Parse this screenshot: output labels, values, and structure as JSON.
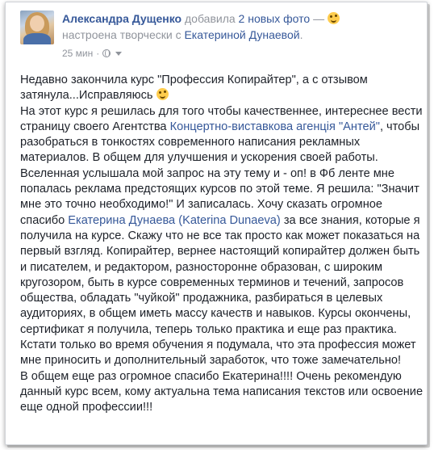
{
  "author": {
    "name": "Александра Дущенко",
    "action": "добавила",
    "photos_link": "2 новых фото",
    "dash": "—",
    "feeling_prefix": "настроена творчески с",
    "tagged": "Екатериной Дунаевой",
    "tagged_suffix": "."
  },
  "timestamp": "25 мин",
  "dot": "·",
  "icons": {
    "feeling": "smiling-emoji-icon",
    "inline_smile": "winking-emoji-icon",
    "audience": "globe-icon",
    "menu": "chevron-down-icon"
  },
  "post": {
    "p1_text": "Недавно закончила курс \"Профессия Копирайтер\", а с отзывом затянула...Исправляюсь ",
    "p2_before": "На этот курс я решилась для того чтобы качественнее, интереснее вести страницу своего Агентства ",
    "p2_link1": "Концертно-виставкова агенція \"Антей\"",
    "p2_middle": ", чтобы разобраться в тонкостях современного написания рекламных материалов. В общем для улучшения и ускорения своей работы. Вселенная услышала мой запрос на эту тему и - оп! в Фб ленте мне попалась реклама предстоящих курсов по этой теме. Я решила: \"Значит мне это точно необходимо!\" И записалась. Хочу сказать огромное спасибо ",
    "p2_link2": "Екатерина Дунаева (Katerina Dunaeva)",
    "p2_after": " за все знания, которые я получила на курсе. Скажу что не все так просто как может показаться на первый взгляд. Копирайтер, вернее настоящий копирайтер должен быть и писателем, и редактором, разносторонне образован, с широким кругозором, быть в курсе современных терминов и течений, запросов общества, обладать \"чуйкой\" продажника, разбираться в целевых аудиториях, в общем иметь массу качеств и навыков. Курсы окончены, сертификат я получила, теперь только практика и еще раз практика. Кстати только во время обучения я подумала, что эта профессия может мне приносить и дополнительный заработок, что тоже замечательно!",
    "p3_text": "В общем еще раз огромное спасибо Екатерина!!!! Очень рекомендую данный курс всем, кому актуальна тема написания текстов или освоение еще одной профессии!!!"
  }
}
